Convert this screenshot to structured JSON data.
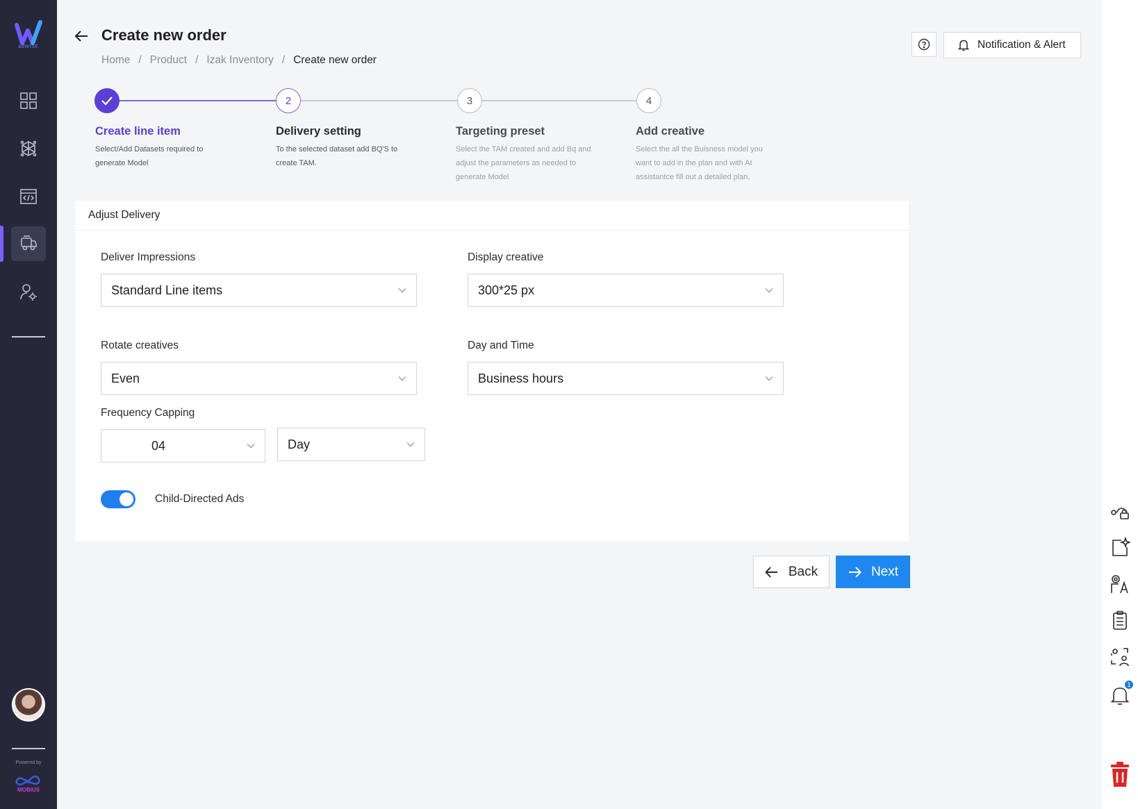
{
  "sidebar": {
    "logo_text": "adWISE",
    "items": [
      {
        "name": "dashboard"
      },
      {
        "name": "network"
      },
      {
        "name": "code"
      },
      {
        "name": "orders"
      },
      {
        "name": "user-settings"
      }
    ],
    "powered_by": "Powered by",
    "partner": "MOBIUS"
  },
  "header": {
    "title": "Create new order",
    "breadcrumb": [
      "Home",
      "/",
      "Product",
      "/",
      "Izak Inventory",
      "/",
      "Create new order"
    ],
    "notification_label": "Notification & Alert"
  },
  "stepper": [
    {
      "number": "1",
      "title": "Create line item",
      "desc": "Select/Add Datasets required to generate Model",
      "state": "done"
    },
    {
      "number": "2",
      "title": "Delivery setting",
      "desc": "To the selected dataset add BQ'S to create TAM.",
      "state": "current"
    },
    {
      "number": "3",
      "title": "Targeting preset",
      "desc": "Select the TAM created and add Bq and adjust the parameters as needed to generate Model",
      "state": "pending"
    },
    {
      "number": "4",
      "title": "Add creative",
      "desc": "Select the all the Buisness model you want to add in the plan and with AI assistantce fill out a detailed plan.",
      "state": "pending"
    }
  ],
  "form": {
    "title": "Adjust Delivery",
    "deliver_impressions": {
      "label": "Deliver Impressions",
      "value": "Standard Line items"
    },
    "display_creative": {
      "label": "Display creative",
      "value": "300*25 px"
    },
    "rotate_creatives": {
      "label": "Rotate creatives",
      "value": "Even"
    },
    "day_and_time": {
      "label": "Day and Time",
      "value": "Business hours"
    },
    "frequency_capping": {
      "label": "Frequency Capping",
      "count": "04",
      "period": "Day"
    },
    "child_directed": {
      "label": "Child-Directed Ads",
      "enabled": true
    }
  },
  "actions": {
    "back": "Back",
    "next": "Next"
  },
  "notifications": {
    "count": "1"
  },
  "colors": {
    "accent": "#5b3fd6",
    "primary": "#1e88f0",
    "sidebar": "#262839",
    "danger": "#e02424"
  }
}
